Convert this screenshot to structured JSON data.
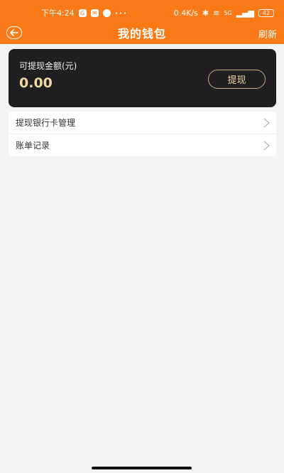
{
  "statusbar": {
    "time": "下午4:24",
    "dots": "···",
    "network_speed": "0.4K/s",
    "signal_label": "5G",
    "battery_level": "42"
  },
  "navbar": {
    "title": "我的钱包",
    "refresh_label": "刷新"
  },
  "wallet": {
    "label": "可提现金额(元)",
    "amount": "0.00",
    "withdraw_label": "提现"
  },
  "menu": {
    "items": [
      {
        "label": "提现银行卡管理"
      },
      {
        "label": "账单记录"
      }
    ]
  },
  "colors": {
    "accent": "#f97a17",
    "card_dark": "#1f1f22",
    "gold": "#f0d6a3"
  }
}
